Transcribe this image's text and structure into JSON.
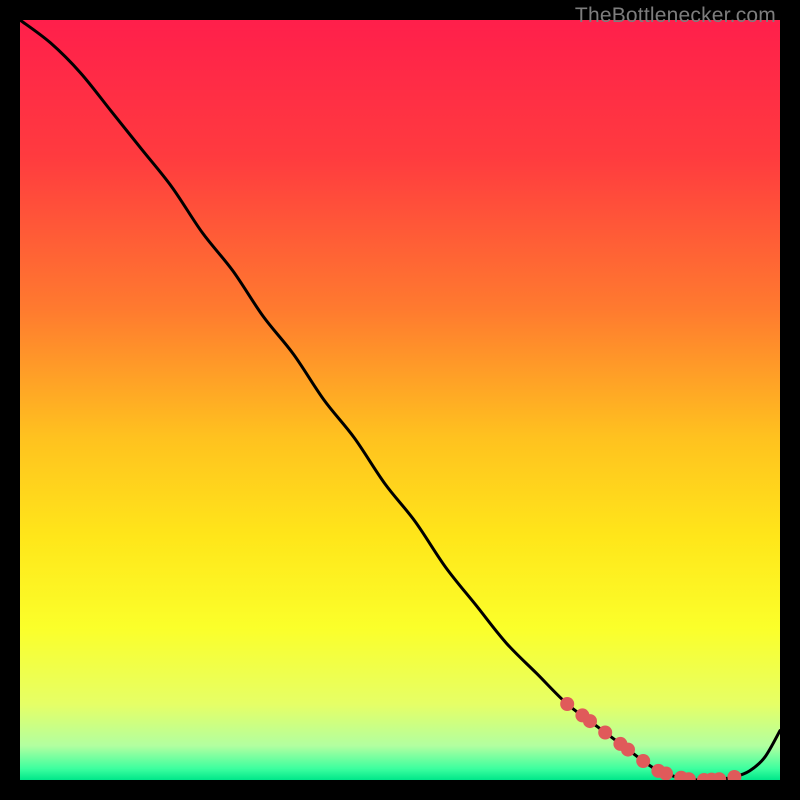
{
  "watermark": "TheBottlenecker.com",
  "gradient": {
    "stops": [
      {
        "offset": 0.0,
        "color": "#ff1f4b"
      },
      {
        "offset": 0.18,
        "color": "#ff3b3f"
      },
      {
        "offset": 0.38,
        "color": "#ff7a2f"
      },
      {
        "offset": 0.55,
        "color": "#ffc21f"
      },
      {
        "offset": 0.68,
        "color": "#ffe61a"
      },
      {
        "offset": 0.8,
        "color": "#fbff2a"
      },
      {
        "offset": 0.9,
        "color": "#e6ff66"
      },
      {
        "offset": 0.955,
        "color": "#b2ffa0"
      },
      {
        "offset": 0.985,
        "color": "#3dff9f"
      },
      {
        "offset": 1.0,
        "color": "#00e68a"
      }
    ]
  },
  "curve_color": "#000000",
  "marker_color": "#e05a5a",
  "chart_data": {
    "type": "line",
    "x": [
      0,
      4,
      8,
      12,
      16,
      20,
      24,
      28,
      32,
      36,
      40,
      44,
      48,
      52,
      56,
      60,
      64,
      68,
      72,
      76,
      80,
      82,
      84,
      86,
      88,
      90,
      92,
      94,
      96,
      98,
      100
    ],
    "y": [
      100,
      97,
      93,
      88,
      83,
      78,
      72,
      67,
      61,
      56,
      50,
      45,
      39,
      34,
      28,
      23,
      18,
      14,
      10,
      7,
      4,
      2.5,
      1.2,
      0.5,
      0.1,
      0.0,
      0.1,
      0.4,
      1.2,
      3.0,
      6.5
    ],
    "title": "",
    "xlabel": "",
    "ylabel": "",
    "xlim": [
      0,
      100
    ],
    "ylim": [
      0,
      100
    ],
    "markers_x": [
      72,
      74,
      75,
      77,
      79,
      80,
      82,
      84,
      85,
      87,
      88,
      90,
      91,
      92,
      94
    ],
    "annotations": [
      "TheBottlenecker.com"
    ]
  }
}
